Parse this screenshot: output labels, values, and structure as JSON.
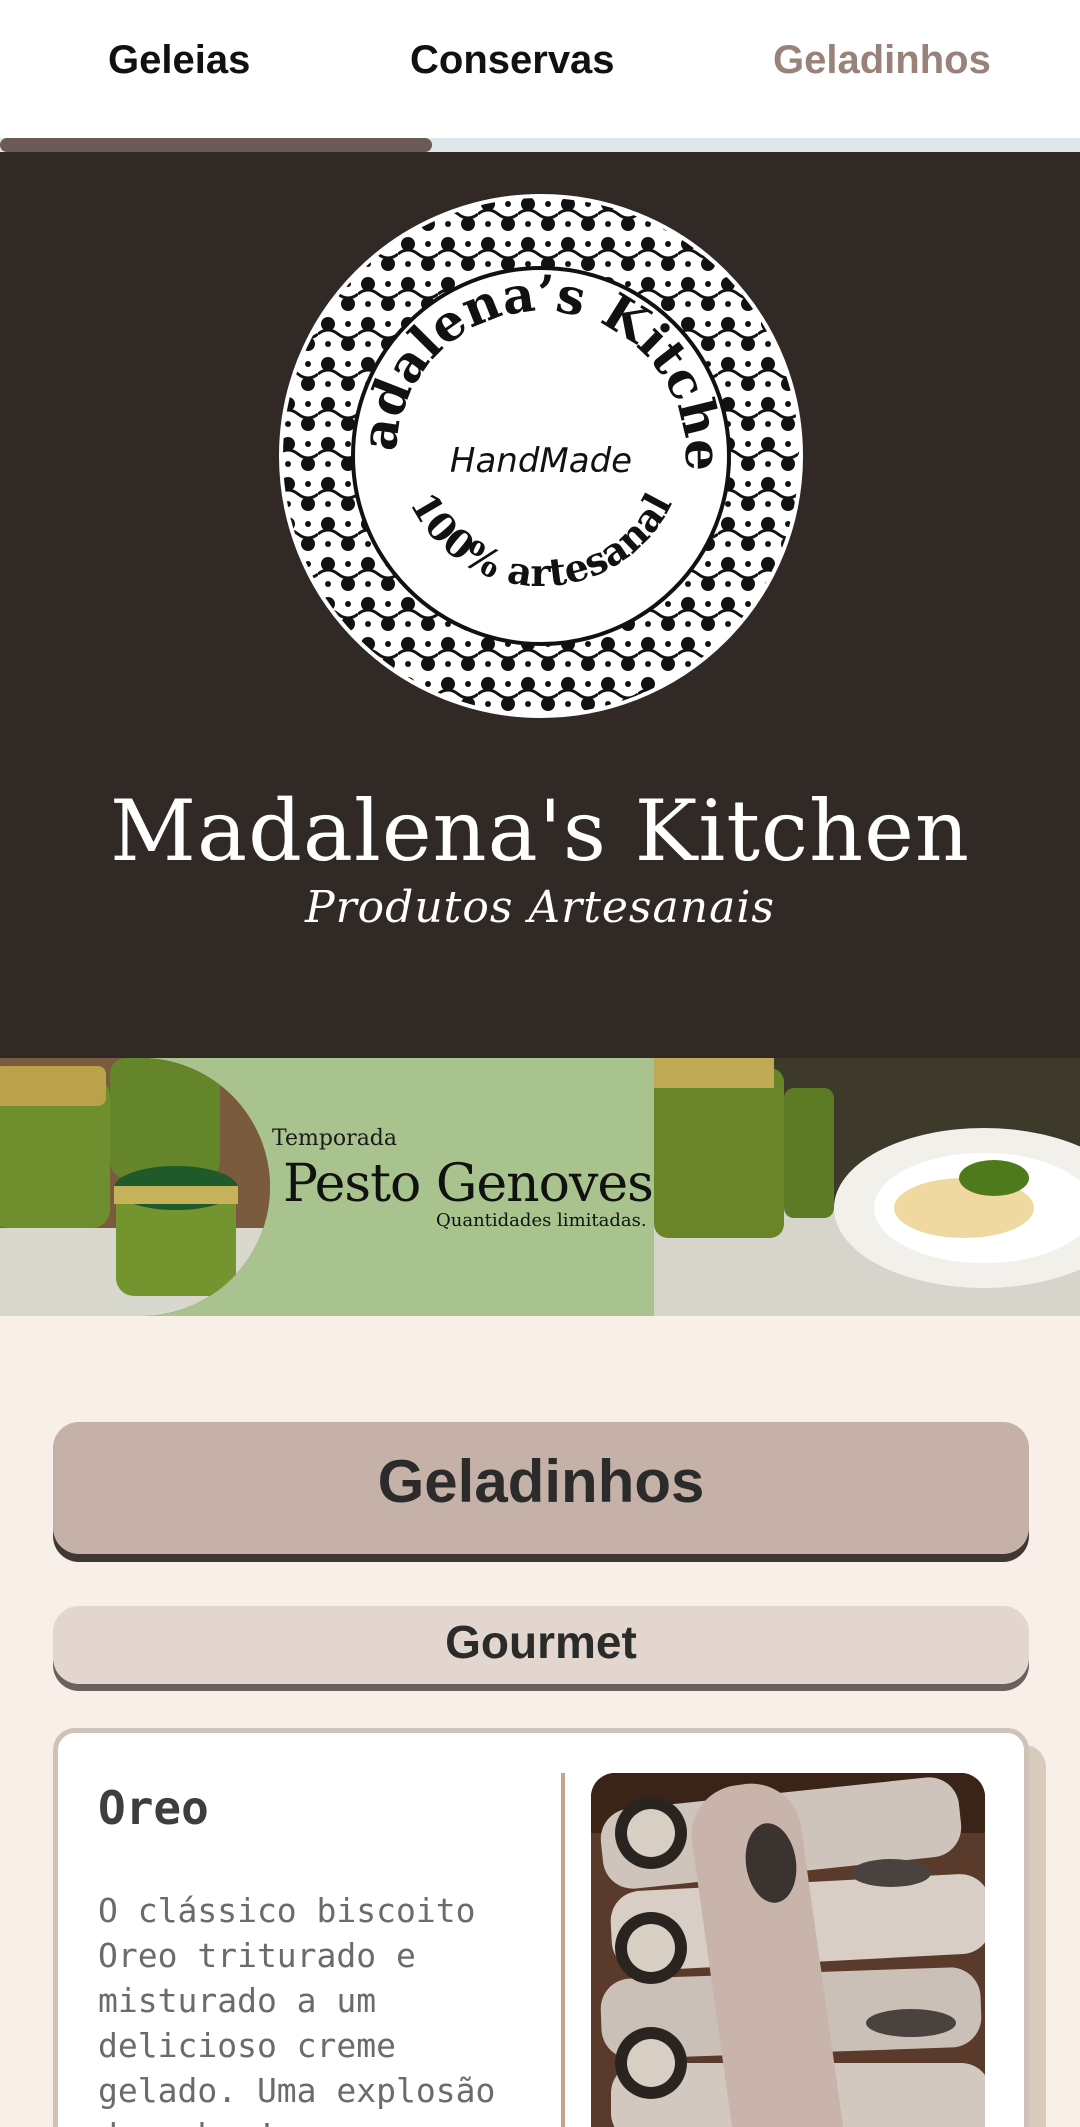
{
  "tabs": [
    {
      "label": "Geleias",
      "active": true
    },
    {
      "label": "Conservas",
      "active": false
    },
    {
      "label": "Geladinhos",
      "active": false
    }
  ],
  "hero": {
    "logo_text_top": "Madalena’s Kitchen",
    "logo_text_center": "HandMade",
    "logo_text_bottom": "100% artesanal",
    "title": "Madalena's Kitchen",
    "subtitle": "Produtos Artesanais"
  },
  "banner": {
    "kicker": "Temporada",
    "title": "Pesto Genovese",
    "note": "Quantidades limitadas."
  },
  "section": {
    "title": "Geladinhos",
    "subtitle": "Gourmet"
  },
  "product": {
    "name": "Oreo",
    "description": "O clássico biscoito Oreo triturado e misturado a um delicioso creme gelado. Uma explosão de sabor!"
  },
  "colors": {
    "hero_bg": "#312925",
    "page_bg": "#f8efe8",
    "tab_indicator": "#6b5a55",
    "tab_inactive": "#9a817a",
    "section_main": "#c5b1a8",
    "section_sub": "#e2d6cf",
    "banner_green": "#a9c38f"
  }
}
